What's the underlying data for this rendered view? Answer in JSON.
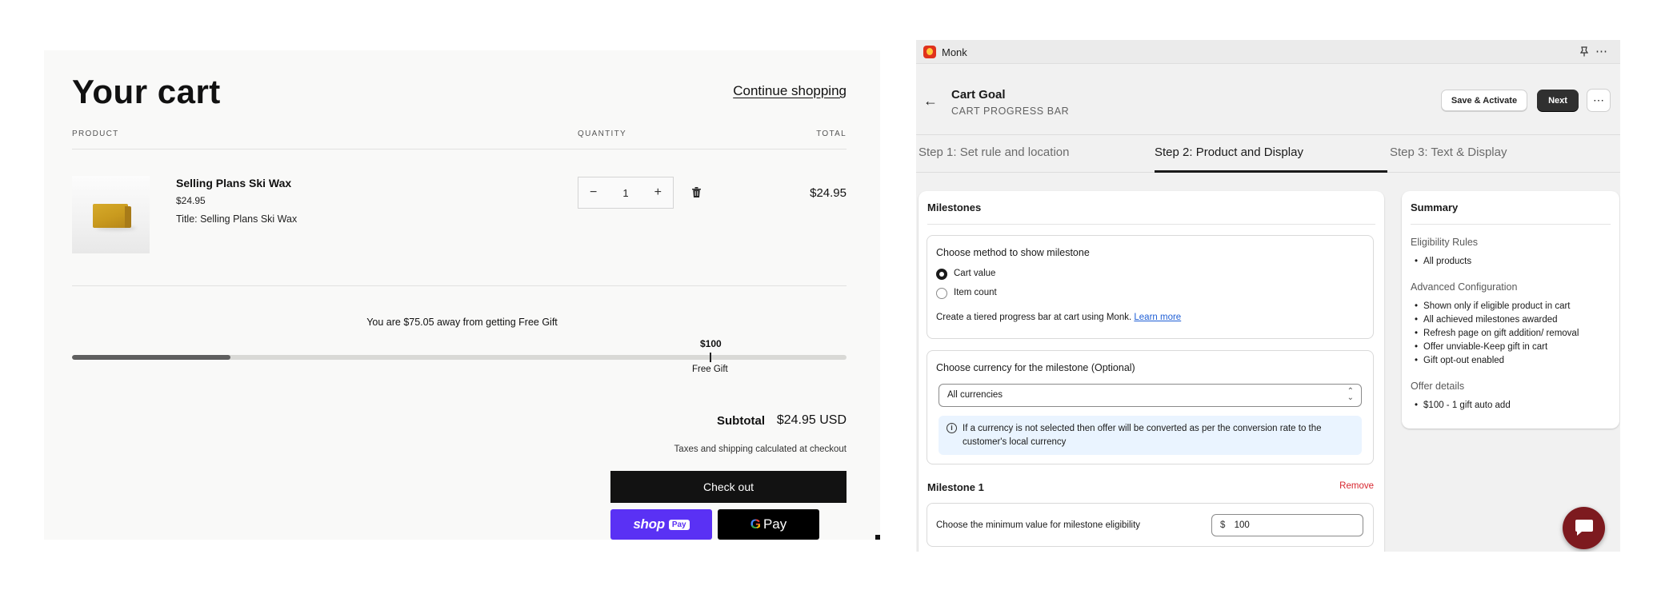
{
  "cart": {
    "title": "Your cart",
    "continue_link": "Continue shopping",
    "headers": {
      "product": "PRODUCT",
      "quantity": "QUANTITY",
      "total": "TOTAL"
    },
    "item": {
      "name": "Selling Plans Ski Wax",
      "price": "$24.95",
      "variant": "Title: Selling Plans Ski Wax",
      "quantity": "1",
      "minus": "−",
      "plus": "+",
      "line_total": "$24.95"
    },
    "progress": {
      "message": "You are $75.05 away from getting Free Gift",
      "milestone_amount": "$100",
      "milestone_label": "Free Gift",
      "fraction": 0.2495,
      "fill_color": "#5f5f5f"
    },
    "subtotal_label": "Subtotal",
    "subtotal_value": "$24.95 USD",
    "tax_note": "Taxes and shipping calculated at checkout",
    "checkout_label": "Check out",
    "shop_pay": {
      "shop": "shop",
      "pay": "Pay",
      "color": "#5a31f4"
    },
    "google_pay": {
      "g": "G",
      "pay": "Pay"
    }
  },
  "app": {
    "name": "Monk",
    "title": "Cart Goal",
    "subtitle": "CART PROGRESS BAR",
    "save_button": "Save & Activate",
    "next_button": "Next",
    "more_button": "⋯",
    "tabs": [
      {
        "label": "Step 1: Set rule and location"
      },
      {
        "label": "Step 2: Product and Display"
      },
      {
        "label": "Step 3: Text & Display"
      }
    ],
    "milestones": {
      "heading": "Milestones",
      "method_label": "Choose method to show milestone",
      "options": [
        "Cart value",
        "Item count"
      ],
      "selected": "Cart value",
      "helper_text": "Create a tiered progress bar at cart using Monk.",
      "helper_link": "Learn more",
      "currency_label": "Choose currency for the milestone (Optional)",
      "currency_value": "All currencies",
      "info_text": "If a currency is not selected then offer will be converted as per the conversion rate to the customer's local currency",
      "milestone_1_label": "Milestone 1",
      "remove_label": "Remove",
      "min_value_label": "Choose the minimum value for milestone eligibility",
      "currency_symbol": "$",
      "min_value": "100"
    },
    "summary": {
      "heading": "Summary",
      "eligibility_title": "Eligibility Rules",
      "eligibility_items": [
        "All products"
      ],
      "advanced_title": "Advanced Configuration",
      "advanced_items": [
        "Shown only if eligible product in cart",
        "All achieved milestones awarded",
        "Refresh page on gift addition/ removal",
        "Offer unviable-Keep gift in cart",
        "Gift opt-out enabled"
      ],
      "offer_title": "Offer details",
      "offer_items": [
        "$100 - 1 gift auto add"
      ]
    },
    "accent_color": "#303030",
    "chat_color": "#7d1a1f"
  }
}
